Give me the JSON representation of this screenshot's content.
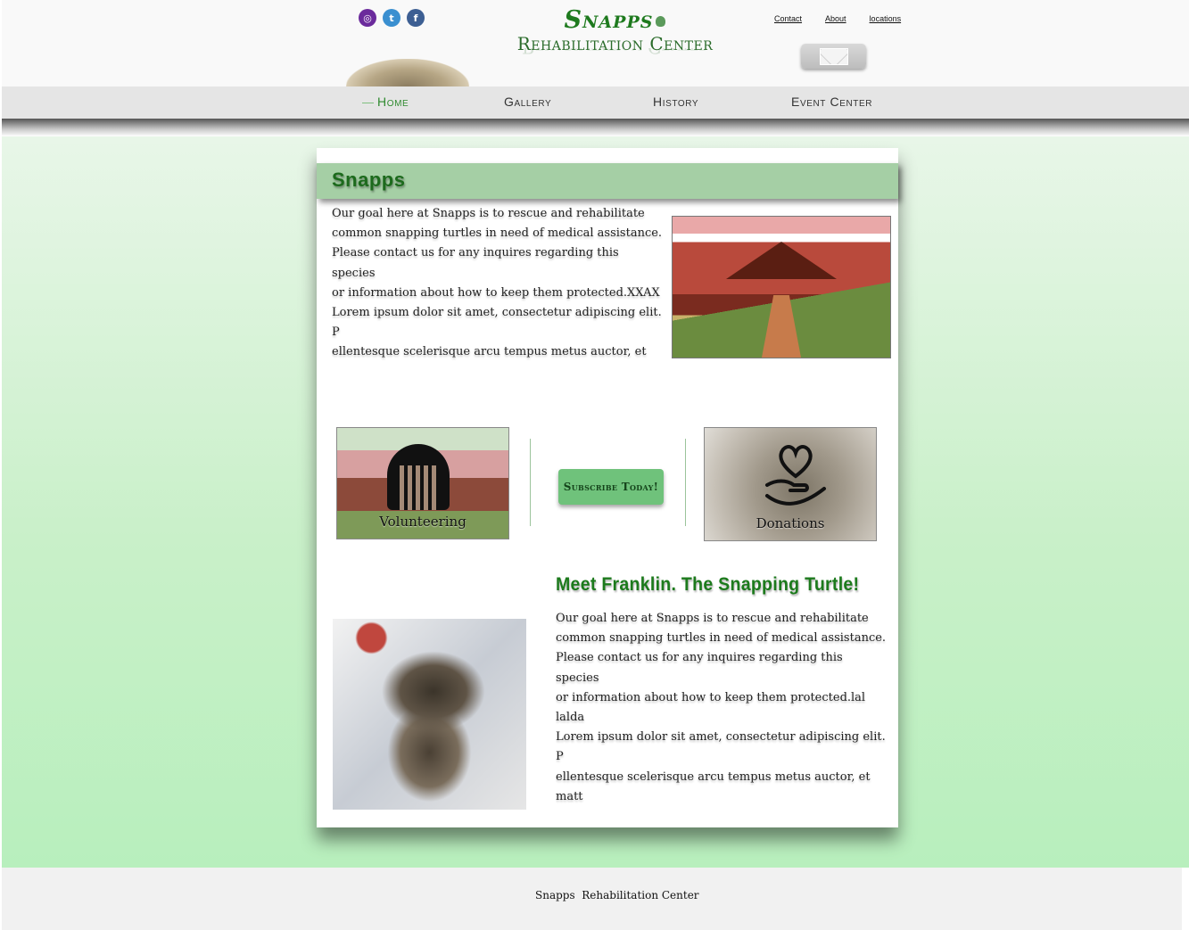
{
  "header": {
    "social": [
      "instagram-icon",
      "twitter-icon",
      "facebook-icon"
    ],
    "logo_title": "Snapps",
    "logo_subtitle": "Rehabilitation Center",
    "links": [
      "Contact",
      "About",
      "locations"
    ]
  },
  "nav": {
    "items": [
      "Home",
      "Gallery",
      "History",
      "Event Center"
    ],
    "active": "Home"
  },
  "main": {
    "title": "Snapps",
    "intro": "Our goal here at Snapps is to rescue and rehabilitate\ncommon snapping turtles in need of medical assistance.\nPlease contact us for any inquires regarding this species\nor information about how to keep them protected.XXAX\nLorem ipsum dolor sit amet, consectetur adipiscing elit. P\nellentesque scelerisque arcu tempus metus auctor, et mattis\n justo faucibus. Donec varius turpis metus, sed gravida lect\nus pretium id. Maecenas cursus urna et malesuada mollis. P",
    "cards": {
      "volunteering": "Volunteering",
      "subscribe": "Subscribe Today!",
      "donations": "Donations"
    },
    "franklin_title": "Meet Franklin. The Snapping Turtle!",
    "franklin_text": "Our goal here at Snapps is to rescue and rehabilitate\ncommon snapping turtles in need of medical assistance.\nPlease contact us for any inquires regarding this species\nor information about how to keep them protected.lal lalda\nLorem ipsum dolor sit amet, consectetur adipiscing elit. P\nellentesque scelerisque arcu tempus metus auctor, et matt\nis justo faucibus. Donec varius turpis metus, sed gravida le\nctus pretium id. Maecenas cursus urna et malesuada mollis\n. Phasellus vitae sodales est. Nam nisl tellus, convallis et ef\nficitur imperdiet, congue a magna. Fusce eu porta arcu, tem"
  },
  "footer": {
    "text": "Snapps  Rehabilitation Center"
  },
  "colors": {
    "accent_green": "#1e7a1e",
    "title_bar": "#a5cfa5",
    "button_green": "#6fc27b"
  }
}
